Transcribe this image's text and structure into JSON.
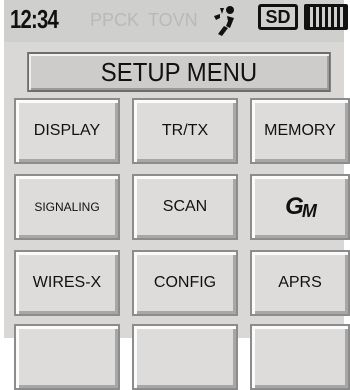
{
  "status_bar": {
    "time": "12:34",
    "ghost_left": "PPCK",
    "ghost_mid": "TOVN",
    "sd_label": "SD",
    "icons": [
      "gps-icon",
      "sd-card-icon",
      "battery-icon"
    ]
  },
  "title": "SETUP MENU",
  "menu": {
    "row1": [
      "DISPLAY",
      "TR/TX",
      "MEMORY"
    ],
    "row2": [
      "SIGNALING",
      "SCAN",
      "GM"
    ],
    "row3": [
      "WIRES-X",
      "CONFIG",
      "APRS"
    ]
  },
  "colors": {
    "background": "#d9d8d6",
    "button_face": "#dddcda",
    "button_border": "#8c8c8c",
    "text": "#111111"
  }
}
